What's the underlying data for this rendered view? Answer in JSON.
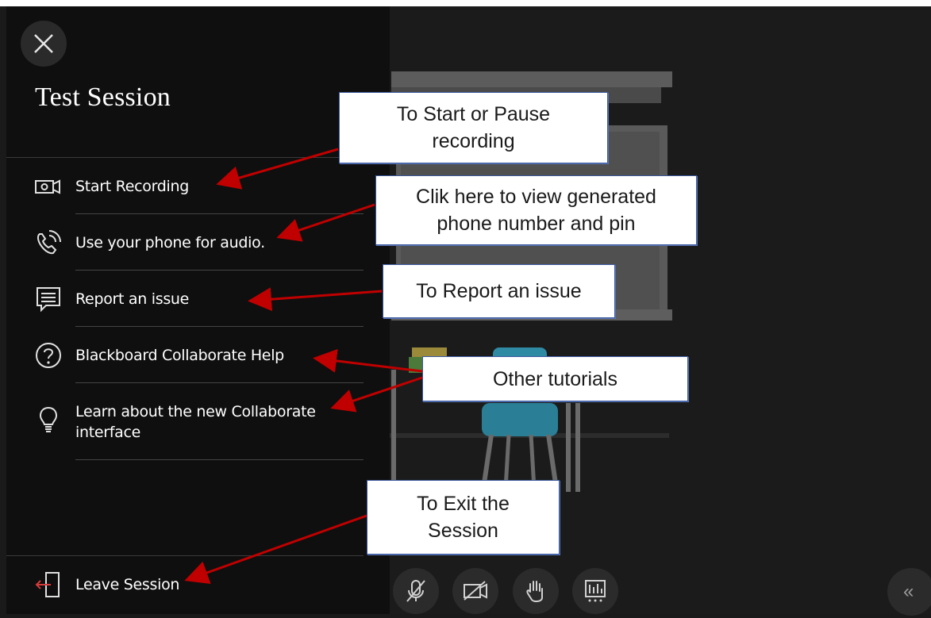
{
  "session": {
    "title": "Test Session"
  },
  "menu": {
    "items": [
      {
        "label": "Start Recording",
        "icon": "camera-icon"
      },
      {
        "label": "Use your phone for audio.",
        "icon": "phone-icon"
      },
      {
        "label": "Report an issue",
        "icon": "feedback-icon"
      },
      {
        "label": "Blackboard Collaborate Help",
        "icon": "help-icon"
      },
      {
        "label": "Learn about the new Collaborate",
        "label2": "interface",
        "icon": "lightbulb-icon"
      }
    ],
    "leave_label": "Leave Session"
  },
  "callouts": {
    "recording": {
      "line1": "To Start or Pause",
      "line2": "recording"
    },
    "phone": {
      "line1": "Clik here to view generated",
      "line2": "phone number and pin"
    },
    "report": {
      "line1": "To Report an issue"
    },
    "tutorials": {
      "line1": "Other tutorials"
    },
    "exit": {
      "line1": "To Exit the",
      "line2": "Session"
    }
  },
  "controls": [
    "microphone-muted-icon",
    "camera-off-icon",
    "raise-hand-icon",
    "share-content-icon",
    "collapse-icon"
  ],
  "colors": {
    "panel": "#0f0f0f",
    "arrow": "#c00000",
    "text": "#ffffff",
    "callout_border": "#3b5aa0"
  }
}
